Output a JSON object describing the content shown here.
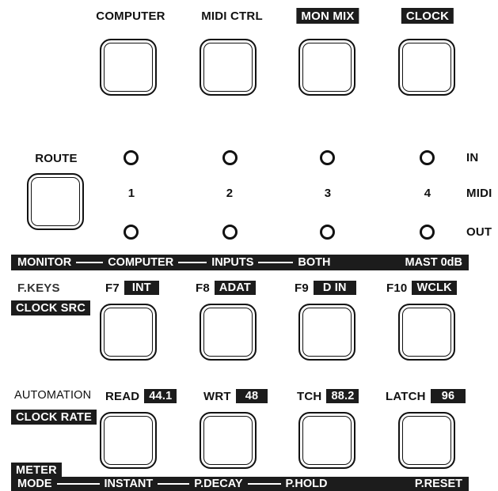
{
  "top_row": {
    "labels": [
      "COMPUTER",
      "MIDI CTRL",
      "MON MIX",
      "CLOCK"
    ]
  },
  "route": {
    "label": "ROUTE",
    "ports": [
      "1",
      "2",
      "3",
      "4"
    ],
    "row_labels": {
      "in": "IN",
      "midi": "MIDI",
      "out": "OUT"
    }
  },
  "monitor_bar": {
    "items": [
      "MONITOR",
      "COMPUTER",
      "INPUTS",
      "BOTH",
      "MAST 0dB"
    ]
  },
  "fkeys": {
    "title": "F.KEYS",
    "subtitle": "CLOCK SRC",
    "keys": [
      {
        "key": "F7",
        "value": "INT"
      },
      {
        "key": "F8",
        "value": "ADAT"
      },
      {
        "key": "F9",
        "value": "D IN"
      },
      {
        "key": "F10",
        "value": "WCLK"
      }
    ]
  },
  "automation": {
    "title": "AUTOMATION",
    "subtitle": "CLOCK RATE",
    "modes": [
      {
        "mode": "READ",
        "rate": "44.1"
      },
      {
        "mode": "WRT",
        "rate": "48"
      },
      {
        "mode": "TCH",
        "rate": "88.2"
      },
      {
        "mode": "LATCH",
        "rate": "96"
      }
    ]
  },
  "meter_bar": {
    "line1": "METER",
    "items": [
      "MODE",
      "INSTANT",
      "P.DECAY",
      "P.HOLD",
      "P.RESET"
    ]
  }
}
